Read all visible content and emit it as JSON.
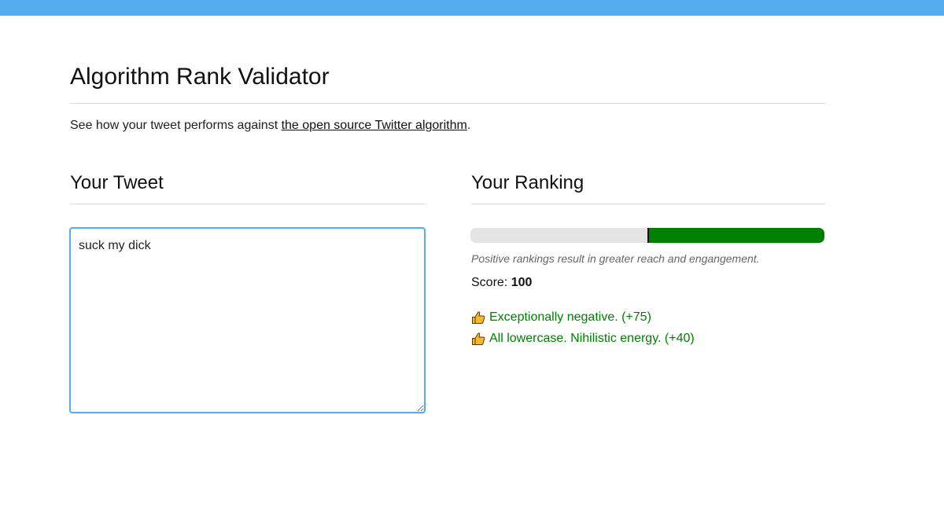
{
  "header": {
    "title": "Algorithm Rank Validator",
    "intro_prefix": "See how your tweet performs against ",
    "intro_link": "the open source Twitter algorithm",
    "intro_suffix": "."
  },
  "tweet": {
    "heading": "Your Tweet",
    "value": "suck my dick"
  },
  "ranking": {
    "heading": "Your Ranking",
    "bar_fill_fraction": 0.5,
    "caption": "Positive rankings result in greater reach and engangement.",
    "score_label": "Score: ",
    "score_value": "100",
    "rules": [
      {
        "icon": "thumbs-up-icon",
        "text": "Exceptionally negative. (+75)"
      },
      {
        "icon": "thumbs-up-icon",
        "text": "All lowercase. Nihilistic energy. (+40)"
      }
    ]
  },
  "colors": {
    "accent": "#55acee",
    "positive": "#008000",
    "track": "#e4e4e4"
  }
}
